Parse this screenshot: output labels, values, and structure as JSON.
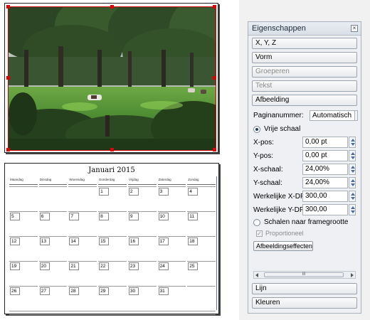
{
  "calendar": {
    "title": "Januari 2015",
    "weekdays": [
      "Maandag",
      "Dinsdag",
      "Woensdag",
      "Donderdag",
      "Vrijdag",
      "Zaterdag",
      "Zondag"
    ],
    "weeks": [
      [
        "",
        "",
        "",
        "1",
        "2",
        "3",
        "4"
      ],
      [
        "5",
        "6",
        "7",
        "8",
        "9",
        "10",
        "11"
      ],
      [
        "12",
        "13",
        "14",
        "15",
        "16",
        "17",
        "18"
      ],
      [
        "19",
        "20",
        "21",
        "22",
        "23",
        "24",
        "25"
      ],
      [
        "26",
        "27",
        "28",
        "29",
        "30",
        "31",
        ""
      ]
    ]
  },
  "panel": {
    "title": "Eigenschappen",
    "close_icon": "close-icon",
    "sections": {
      "xyz": "X, Y, Z",
      "shape": "Vorm",
      "group": "Groeperen",
      "text": "Tekst",
      "image": "Afbeelding",
      "line": "Lijn",
      "colors": "Kleuren"
    },
    "page_number": {
      "label": "Paginanummer:",
      "value": "Automatisch"
    },
    "free_scale": {
      "label": "Vrije schaal",
      "selected": true
    },
    "fields": {
      "xpos": {
        "label": "X-pos:",
        "value": "0,00 pt"
      },
      "ypos": {
        "label": "Y-pos:",
        "value": "0,00 pt"
      },
      "xscale": {
        "label": "X-schaal:",
        "value": "24,00%"
      },
      "yscale": {
        "label": "Y-schaal:",
        "value": "24,00%"
      },
      "xdpi": {
        "label": "Werkelijke X-DPI:",
        "value": "300,00"
      },
      "ydpi": {
        "label": "Werkelijke Y-DPI:",
        "value": "300,00"
      }
    },
    "scale_to_frame": {
      "label": "Schalen naar framegrootte",
      "selected": false
    },
    "proportional": {
      "label": "Proportioneel",
      "checked": true
    },
    "effects_button": "Afbeeldingseffecten",
    "scroll_thumb": "III"
  }
}
